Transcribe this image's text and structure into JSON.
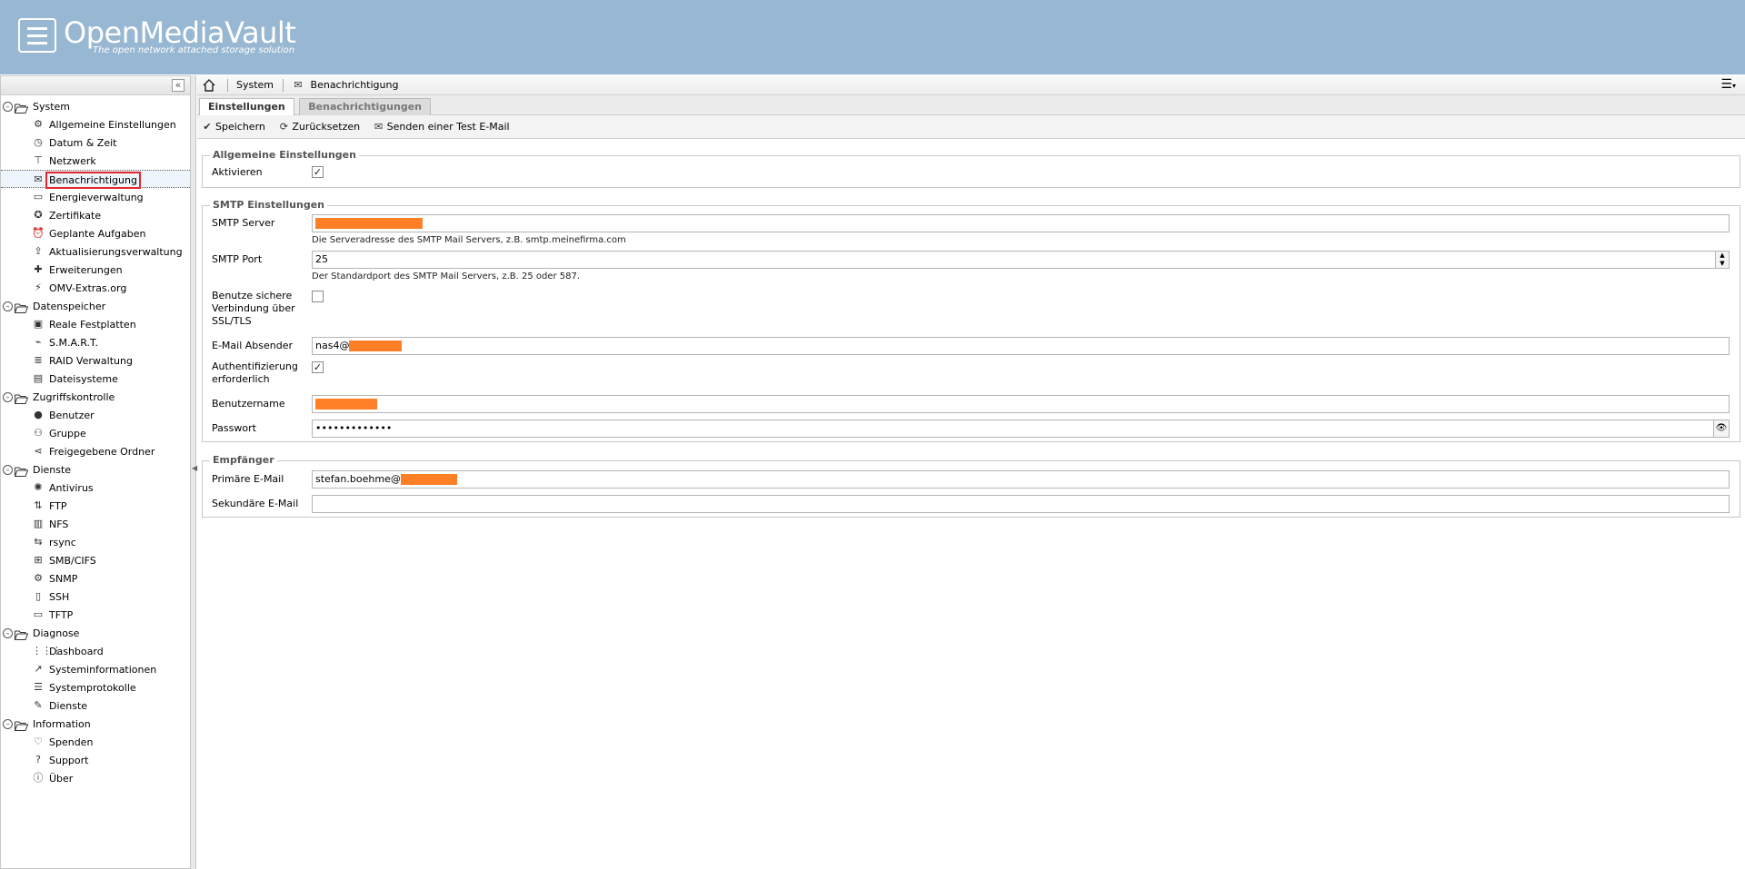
{
  "header": {
    "title": "OpenMediaVault",
    "subtitle": "The open network attached storage solution"
  },
  "sidebar": {
    "collapse_glyph": "«",
    "categories": [
      {
        "label": "System",
        "items": [
          {
            "label": "Allgemeine Einstellungen",
            "icon": "gears-icon"
          },
          {
            "label": "Datum & Zeit",
            "icon": "clock-icon"
          },
          {
            "label": "Netzwerk",
            "icon": "network-icon"
          },
          {
            "label": "Benachrichtigung",
            "icon": "envelope-icon",
            "selected": true
          },
          {
            "label": "Energieverwaltung",
            "icon": "battery-icon"
          },
          {
            "label": "Zertifikate",
            "icon": "certificate-icon"
          },
          {
            "label": "Geplante Aufgaben",
            "icon": "alarm-clock-icon"
          },
          {
            "label": "Aktualisierungsverwaltung",
            "icon": "update-icon"
          },
          {
            "label": "Erweiterungen",
            "icon": "puzzle-icon"
          },
          {
            "label": "OMV-Extras.org",
            "icon": "plug-icon"
          }
        ]
      },
      {
        "label": "Datenspeicher",
        "items": [
          {
            "label": "Reale Festplatten",
            "icon": "harddisk-icon"
          },
          {
            "label": "S.M.A.R.T.",
            "icon": "smart-icon"
          },
          {
            "label": "RAID Verwaltung",
            "icon": "database-icon"
          },
          {
            "label": "Dateisysteme",
            "icon": "filesystem-icon"
          }
        ]
      },
      {
        "label": "Zugriffskontrolle",
        "items": [
          {
            "label": "Benutzer",
            "icon": "user-icon"
          },
          {
            "label": "Gruppe",
            "icon": "group-icon"
          },
          {
            "label": "Freigegebene Ordner",
            "icon": "share-icon"
          }
        ]
      },
      {
        "label": "Dienste",
        "items": [
          {
            "label": "Antivirus",
            "icon": "virus-icon"
          },
          {
            "label": "FTP",
            "icon": "ftp-icon"
          },
          {
            "label": "NFS",
            "icon": "nfs-icon"
          },
          {
            "label": "rsync",
            "icon": "rsync-icon"
          },
          {
            "label": "SMB/CIFS",
            "icon": "windows-icon"
          },
          {
            "label": "SNMP",
            "icon": "snmp-icon"
          },
          {
            "label": "SSH",
            "icon": "terminal-icon"
          },
          {
            "label": "TFTP",
            "icon": "monitor-icon"
          }
        ]
      },
      {
        "label": "Diagnose",
        "items": [
          {
            "label": "Dashboard",
            "icon": "dashboard-icon"
          },
          {
            "label": "Systeminformationen",
            "icon": "chart-line-icon"
          },
          {
            "label": "Systemprotokolle",
            "icon": "log-icon"
          },
          {
            "label": "Dienste",
            "icon": "wrench-icon"
          }
        ]
      },
      {
        "label": "Information",
        "items": [
          {
            "label": "Spenden",
            "icon": "heart-icon"
          },
          {
            "label": "Support",
            "icon": "question-icon"
          },
          {
            "label": "Über",
            "icon": "info-icon"
          }
        ]
      }
    ]
  },
  "breadcrumb": {
    "system": "System",
    "current": "Benachrichtigung"
  },
  "tabs": {
    "settings": "Einstellungen",
    "notifications": "Benachrichtigungen"
  },
  "toolbar": {
    "save": "Speichern",
    "reset": "Zurücksetzen",
    "test": "Senden einer Test E-Mail"
  },
  "general": {
    "legend": "Allgemeine Einstellungen",
    "enable_label": "Aktivieren",
    "enable_checked": "✓"
  },
  "smtp": {
    "legend": "SMTP Einstellungen",
    "server_label": "SMTP Server",
    "server_hint": "Die Serveradresse des SMTP Mail Servers, z.B. smtp.meinefirma.com",
    "port_label": "SMTP Port",
    "port_value": "25",
    "port_hint": "Der Standardport des SMTP Mail Servers, z.B. 25 oder 587.",
    "ssl_label_1": "Benutze sichere",
    "ssl_label_2": "Verbindung über",
    "ssl_label_3": "SSL/TLS",
    "sender_label": "E-Mail Absender",
    "sender_value": "nas4@",
    "auth_label_1": "Authentifizierung",
    "auth_label_2": "erforderlich",
    "auth_checked": "✓",
    "user_label": "Benutzername",
    "password_label": "Passwort",
    "password_value": "•••••••••••••"
  },
  "recipient": {
    "legend": "Empfänger",
    "primary_label": "Primäre E-Mail",
    "primary_value": "stefan.boehme@",
    "secondary_label": "Sekundäre E-Mail"
  },
  "colors": {
    "header": "#98b7d2",
    "redaction": "#ff7f27",
    "selection_outline": "#e5262e"
  }
}
